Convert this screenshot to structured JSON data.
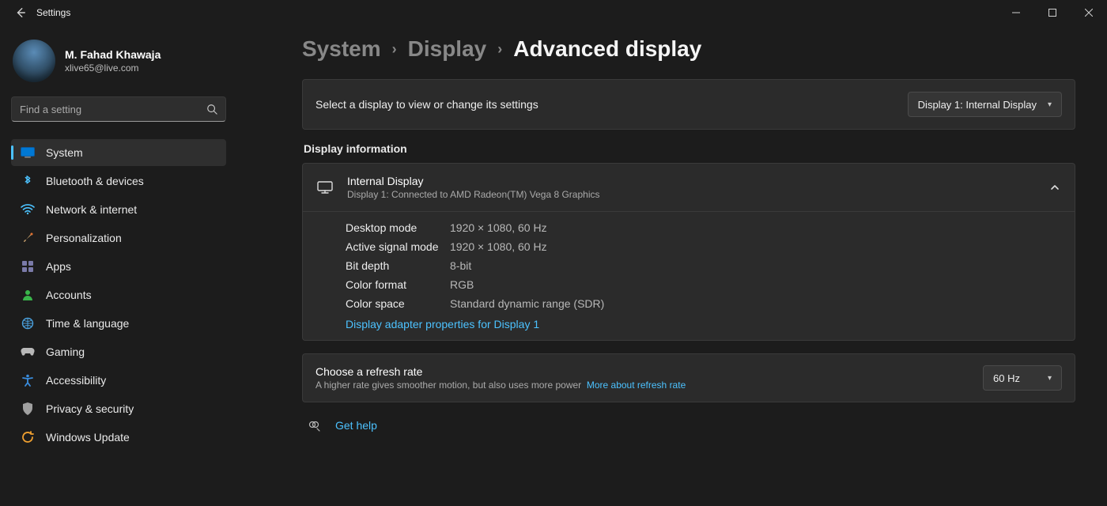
{
  "app_title": "Settings",
  "user": {
    "name": "M. Fahad Khawaja",
    "email": "xlive65@live.com"
  },
  "search": {
    "placeholder": "Find a setting"
  },
  "nav": {
    "items": [
      {
        "label": "System"
      },
      {
        "label": "Bluetooth & devices"
      },
      {
        "label": "Network & internet"
      },
      {
        "label": "Personalization"
      },
      {
        "label": "Apps"
      },
      {
        "label": "Accounts"
      },
      {
        "label": "Time & language"
      },
      {
        "label": "Gaming"
      },
      {
        "label": "Accessibility"
      },
      {
        "label": "Privacy & security"
      },
      {
        "label": "Windows Update"
      }
    ]
  },
  "breadcrumb": {
    "l1": "System",
    "l2": "Display",
    "l3": "Advanced display"
  },
  "select_display": {
    "label": "Select a display to view or change its settings",
    "value": "Display 1: Internal Display"
  },
  "display_info": {
    "section_title": "Display information",
    "title": "Internal Display",
    "subtitle": "Display 1: Connected to AMD Radeon(TM) Vega 8 Graphics",
    "props": {
      "desktop_mode_k": "Desktop mode",
      "desktop_mode_v": "1920 × 1080, 60 Hz",
      "active_signal_k": "Active signal mode",
      "active_signal_v": "1920 × 1080, 60 Hz",
      "bit_depth_k": "Bit depth",
      "bit_depth_v": "8-bit",
      "color_format_k": "Color format",
      "color_format_v": "RGB",
      "color_space_k": "Color space",
      "color_space_v": "Standard dynamic range (SDR)"
    },
    "adapter_link": "Display adapter properties for Display 1"
  },
  "refresh": {
    "title": "Choose a refresh rate",
    "subtitle": "A higher rate gives smoother motion, but also uses more power",
    "more_link": "More about refresh rate",
    "value": "60 Hz"
  },
  "help": {
    "label": "Get help"
  }
}
